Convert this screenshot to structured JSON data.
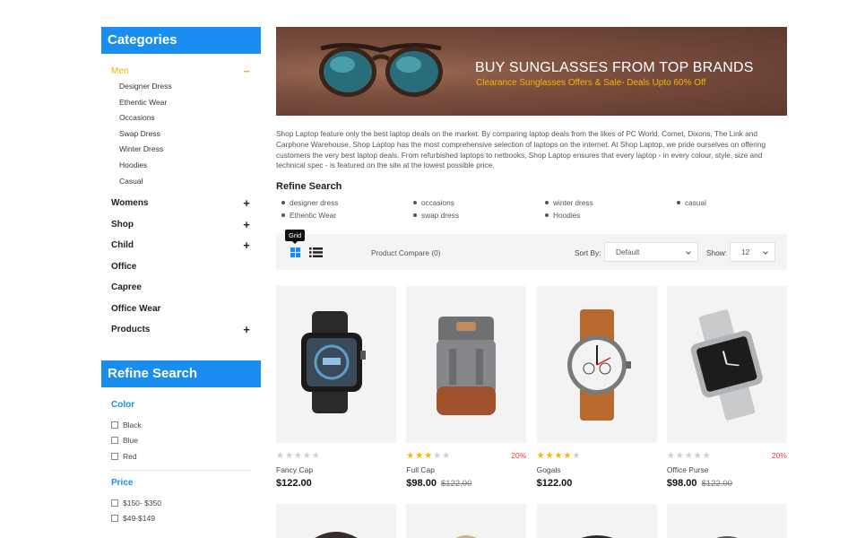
{
  "sidebar": {
    "categories_title": "Categories",
    "active_category": {
      "label": "Men",
      "sign": "−"
    },
    "sub_items": [
      "Designer Dress",
      "Ethentic Wear",
      "Occasions",
      "Swap Dress",
      "Winter Dress",
      "Hoodies",
      "Casual"
    ],
    "categories": [
      {
        "label": "Womens",
        "sign": "+"
      },
      {
        "label": "Shop",
        "sign": "+"
      },
      {
        "label": "Child",
        "sign": "+"
      },
      {
        "label": "Office",
        "sign": ""
      },
      {
        "label": "Capree",
        "sign": ""
      },
      {
        "label": "Office Wear",
        "sign": ""
      },
      {
        "label": "Products",
        "sign": "+"
      }
    ],
    "refine_title": "Refine Search",
    "color_title": "Color",
    "colors": [
      "Black",
      "Blue",
      "Red"
    ],
    "price_title": "Price",
    "prices": [
      "$150- $350",
      "$49-$149"
    ]
  },
  "banner": {
    "title": "BUY SUNGLASSES FROM TOP BRANDS",
    "subtitle": "Clearance Sunglasses Offers & Sale- Deals Upto 60% Off"
  },
  "description": "Shop Laptop feature only the best laptop deals on the market. By comparing laptop deals from the likes of PC World, Comet, Dixons, The Link and Carphone Warehouse, Shop Laptop has the most comprehensive selection of laptops on the internet. At Shop Laptop, we pride ourselves on offering customers the very best laptop deals. From refurbished laptops to netbooks, Shop Laptop ensures that every laptop - in every colour, style, size and technical spec - is featured on the site at the lowest possible price.",
  "refine": {
    "title": "Refine Search",
    "tags": [
      "designer dress",
      "occasions",
      "winter dress",
      "casual",
      "Ethentic Wear",
      "swap dress",
      "Hoodies"
    ]
  },
  "toolbar": {
    "tooltip": "Grid",
    "compare": "Product Compare (0)",
    "sort_label": "Sort By:",
    "sort_value": "Default",
    "show_label": "Show:",
    "show_value": "12"
  },
  "products": [
    {
      "name": "Fancy Cap",
      "price": "$122.00",
      "old_price": "",
      "discount": "",
      "rating": 0
    },
    {
      "name": "Full Cap",
      "price": "$98.00",
      "old_price": "$122.00",
      "discount": "20%",
      "rating": 3
    },
    {
      "name": "Gogals",
      "price": "$122.00",
      "old_price": "",
      "discount": "",
      "rating": 4
    },
    {
      "name": "Office Purse",
      "price": "$98.00",
      "old_price": "$122.00",
      "discount": "20%",
      "rating": 0
    }
  ],
  "colors": {
    "accent": "#1a8ef0",
    "highlight": "#f5b400",
    "discount": "#e53935"
  }
}
